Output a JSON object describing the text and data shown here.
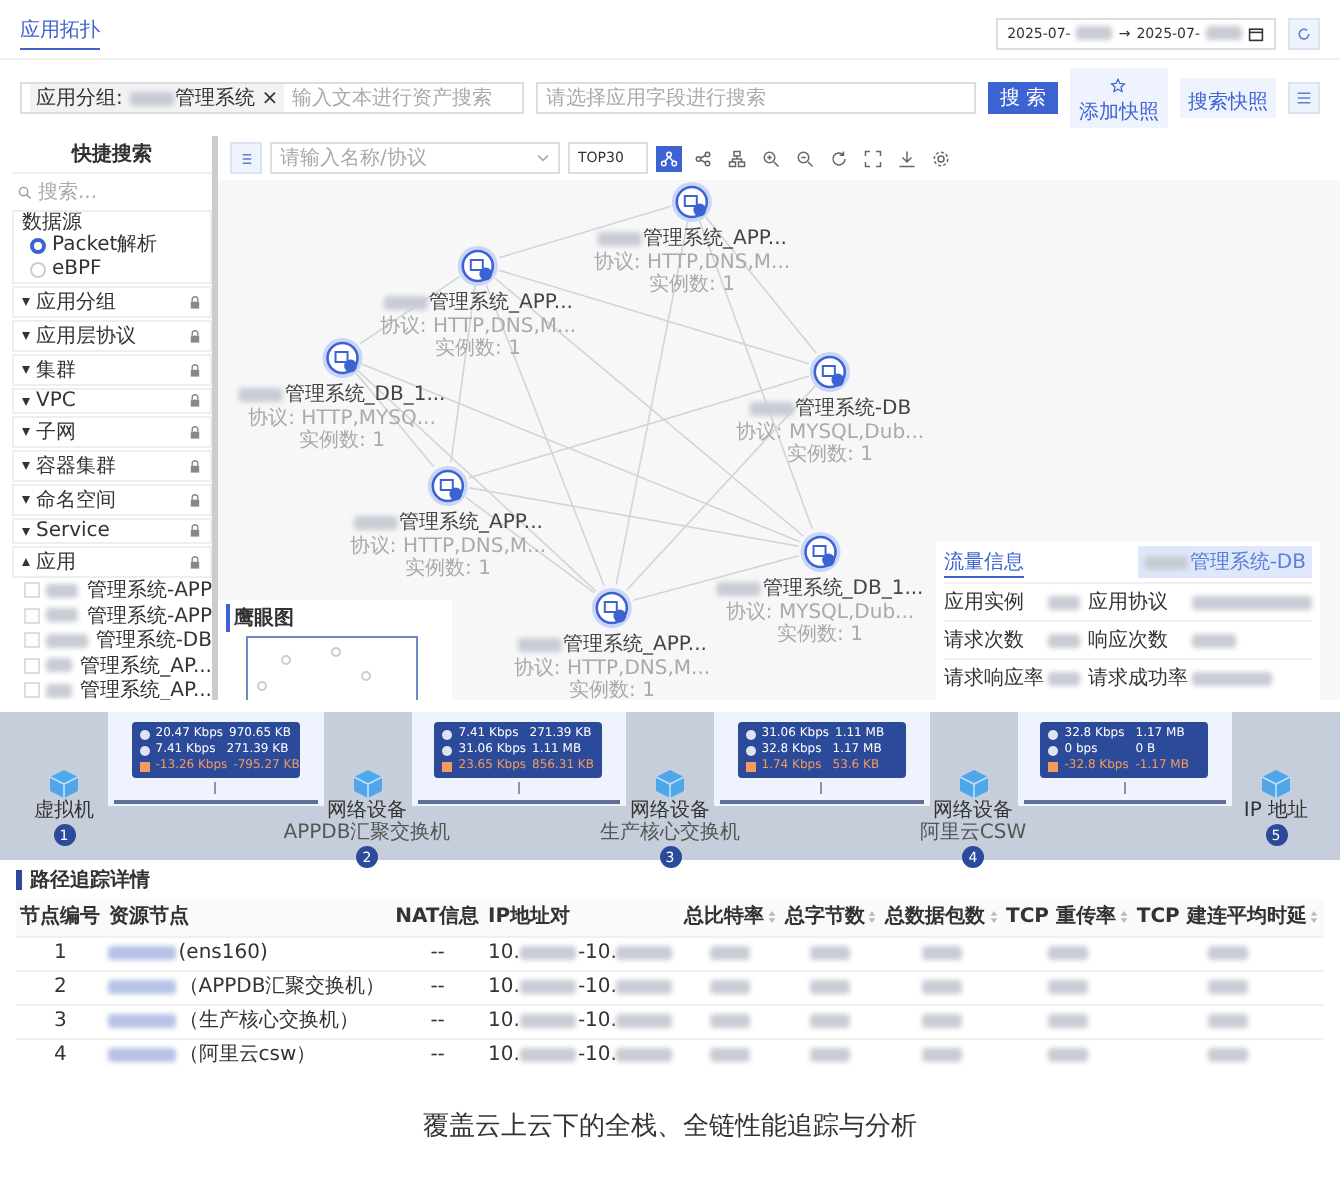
{
  "header": {
    "tab": "应用拓扑",
    "date_from": "2025-07-",
    "arrow": "→",
    "date_to": "2025-07-"
  },
  "search": {
    "chip_label": "应用分组:",
    "chip_value": "管理系统",
    "chip_close": "×",
    "placeholder": "输入文本进行资产搜索",
    "field_placeholder": "请选择应用字段进行搜索",
    "button": "搜 索",
    "add_snapshot": "添加快照",
    "snapshots": "搜索快照"
  },
  "sidebar": {
    "title": "快捷搜索",
    "search_placeholder": "搜索...",
    "source_title": "数据源",
    "sources": [
      {
        "label": "Packet解析",
        "selected": true
      },
      {
        "label": "eBPF",
        "selected": false
      }
    ],
    "groups": [
      {
        "label": "应用分组",
        "expanded": false
      },
      {
        "label": "应用层协议",
        "expanded": false
      },
      {
        "label": "集群",
        "expanded": false
      },
      {
        "label": "VPC",
        "expanded": false
      },
      {
        "label": "子网",
        "expanded": false
      },
      {
        "label": "容器集群",
        "expanded": false
      },
      {
        "label": "命名空间",
        "expanded": false
      },
      {
        "label": "Service",
        "expanded": false
      },
      {
        "label": "应用",
        "expanded": true
      }
    ],
    "apps": [
      {
        "label": "管理系统-APP",
        "checked": false
      },
      {
        "label": "管理系统-APP",
        "checked": false
      },
      {
        "label": "管理系统-DB",
        "checked": false
      },
      {
        "label": "管理系统_AP...",
        "checked": false
      },
      {
        "label": "管理系统_AP...",
        "checked": false
      }
    ]
  },
  "graph": {
    "filter_placeholder": "请输入名称/协议",
    "top": "TOP30",
    "tools": [
      {
        "kind": "layout",
        "selected": true
      },
      {
        "kind": "share",
        "selected": false
      },
      {
        "kind": "tree",
        "selected": false
      },
      {
        "kind": "zoom-in",
        "selected": false
      },
      {
        "kind": "zoom-out",
        "selected": false
      },
      {
        "kind": "refresh",
        "selected": false
      },
      {
        "kind": "fullscreen",
        "selected": false
      },
      {
        "kind": "download",
        "selected": false
      },
      {
        "kind": "settings",
        "selected": false
      }
    ],
    "nodes": [
      {
        "name": "管理系统_APP...",
        "protocol": "协议: HTTP,DNS,M...",
        "instances": "实例数: 1"
      },
      {
        "name": "管理系统_APP...",
        "protocol": "协议: HTTP,DNS,M...",
        "instances": "实例数: 1"
      },
      {
        "name": "管理系统_DB_1...",
        "protocol": "协议: HTTP,MYSQ...",
        "instances": "实例数: 1"
      },
      {
        "name": "管理系统-DB",
        "protocol": "协议: MYSQL,Dub...",
        "instances": "实例数: 1"
      },
      {
        "name": "管理系统_APP...",
        "protocol": "协议: HTTP,DNS,M...",
        "instances": "实例数: 1"
      },
      {
        "name": "管理系统_DB_1...",
        "protocol": "协议: MYSQL,Dub...",
        "instances": "实例数: 1"
      },
      {
        "name": "管理系统_APP...",
        "protocol": "协议: HTTP,DNS,M...",
        "instances": "实例数: 1"
      }
    ],
    "overview_title": "鹰眼图"
  },
  "info": {
    "tab": "流量信息",
    "app_button": "管理系统-DB",
    "rows": [
      {
        "left": "应用实例",
        "right": "应用协议"
      },
      {
        "left": "请求次数",
        "right": "响应次数"
      },
      {
        "left": "请求响应率",
        "right": "请求成功率"
      }
    ]
  },
  "path": {
    "hops": [
      {
        "type": "虚拟机",
        "number": "1"
      },
      {
        "type": "网络设备",
        "sub": "APPDB汇聚交换机",
        "number": "2"
      },
      {
        "type": "网络设备",
        "sub": "生产核心交换机",
        "number": "3"
      },
      {
        "type": "网络设备",
        "sub": "阿里云CSW",
        "number": "4"
      },
      {
        "type": "IP 地址",
        "number": "5"
      }
    ],
    "links": [
      {
        "rows": [
          {
            "kind": "in",
            "rate": "20.47 Kbps",
            "bytes": "970.65 KB"
          },
          {
            "kind": "out",
            "rate": "7.41 Kbps",
            "bytes": "271.39 KB"
          },
          {
            "kind": "diff",
            "rate": "-13.26 Kbps",
            "bytes": "-795.27 KB"
          }
        ]
      },
      {
        "rows": [
          {
            "kind": "in",
            "rate": "7.41 Kbps",
            "bytes": "271.39 KB"
          },
          {
            "kind": "out",
            "rate": "31.06 Kbps",
            "bytes": "1.11 MB"
          },
          {
            "kind": "diff",
            "rate": "23.65 Kbps",
            "bytes": "856.31 KB"
          }
        ]
      },
      {
        "rows": [
          {
            "kind": "in",
            "rate": "31.06 Kbps",
            "bytes": "1.11 MB"
          },
          {
            "kind": "out",
            "rate": "32.8 Kbps",
            "bytes": "1.17 MB"
          },
          {
            "kind": "diff",
            "rate": "1.74 Kbps",
            "bytes": "53.6 KB"
          }
        ]
      },
      {
        "rows": [
          {
            "kind": "in",
            "rate": "32.8 Kbps",
            "bytes": "1.17 MB"
          },
          {
            "kind": "out",
            "rate": "0 bps",
            "bytes": "0 B"
          },
          {
            "kind": "diff",
            "rate": "-32.8 Kbps",
            "bytes": "-1.17 MB"
          }
        ]
      }
    ]
  },
  "details": {
    "title": "路径追踪详情",
    "columns": [
      {
        "label": "节点编号",
        "sortable": false
      },
      {
        "label": "资源节点",
        "sortable": false
      },
      {
        "label": "NAT信息",
        "sortable": false
      },
      {
        "label": "IP地址对",
        "sortable": false
      },
      {
        "label": "总比特率",
        "sortable": true
      },
      {
        "label": "总字节数",
        "sortable": true
      },
      {
        "label": "总数据包数",
        "sortable": true
      },
      {
        "label": "TCP 重传率",
        "sortable": true
      },
      {
        "label": "TCP 建连平均时延",
        "sortable": true
      }
    ],
    "rows": [
      {
        "index": "1",
        "resource": "(ens160)",
        "nat": "--",
        "ip_from": "10.",
        "ip_to": "-10."
      },
      {
        "index": "2",
        "resource": "（APPDB汇聚交换机）",
        "nat": "--",
        "ip_from": "10.",
        "ip_to": "-10."
      },
      {
        "index": "3",
        "resource": "（生产核心交换机）",
        "nat": "--",
        "ip_from": "10.",
        "ip_to": "-10."
      },
      {
        "index": "4",
        "resource": "（阿里云csw）",
        "nat": "--",
        "ip_from": "10.",
        "ip_to": "-10."
      }
    ]
  },
  "caption": "覆盖云上云下的全栈、全链性能追踪与分析"
}
